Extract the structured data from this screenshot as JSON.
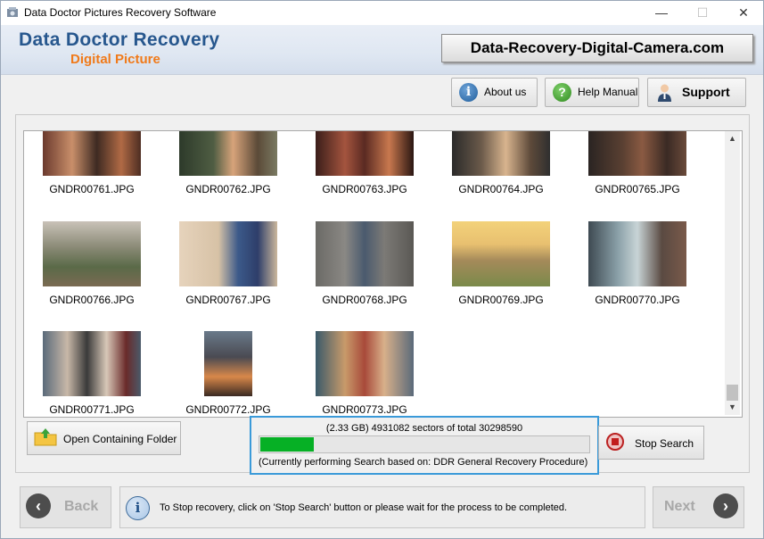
{
  "window": {
    "title": "Data Doctor Pictures Recovery Software",
    "minimize": "—",
    "maximize": "☐",
    "close": "✕"
  },
  "banner": {
    "brand_line1": "Data Doctor Recovery",
    "brand_line2": "Digital Picture",
    "url": "Data-Recovery-Digital-Camera.com"
  },
  "toolbar": {
    "about": "About us",
    "help": "Help Manual",
    "support": "Support"
  },
  "gallery": {
    "files": [
      "GNDR00761.JPG",
      "GNDR00762.JPG",
      "GNDR00763.JPG",
      "GNDR00764.JPG",
      "GNDR00765.JPG",
      "GNDR00766.JPG",
      "GNDR00767.JPG",
      "GNDR00768.JPG",
      "GNDR00769.JPG",
      "GNDR00770.JPG",
      "GNDR00771.JPG",
      "GNDR00772.JPG",
      "GNDR00773.JPG"
    ]
  },
  "open_folder": "Open Containing Folder",
  "progress": {
    "text": "(2.33 GB) 4931082  sectors  of  total 30298590",
    "sectors_done": 4931082,
    "sectors_total": 30298590,
    "status": "(Currently performing Search based on:  DDR General Recovery Procedure)"
  },
  "stop_button": "Stop Search",
  "footer": {
    "back": "Back",
    "next": "Next",
    "message": "To Stop recovery, click on 'Stop Search' button or please wait for the process to be completed."
  },
  "colors": {
    "brand_blue": "#27578e",
    "brand_orange": "#f07a1a",
    "progress_green": "#06b025",
    "progress_border": "#3a9ad9"
  }
}
